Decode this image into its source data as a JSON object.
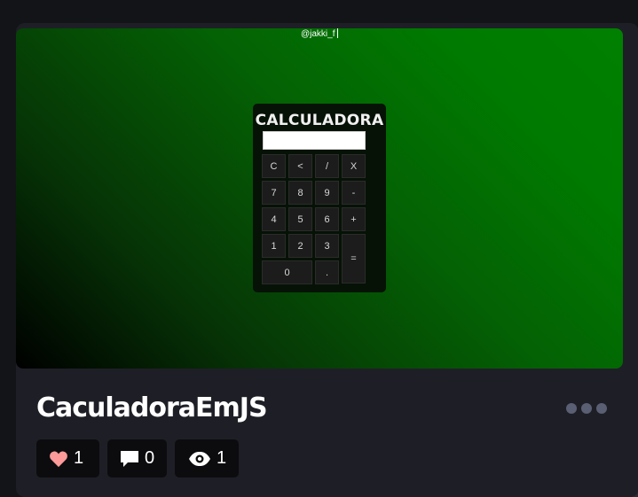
{
  "preview": {
    "author": "@jakki_f",
    "calculator": {
      "title": "CALCULADORA",
      "display_value": "",
      "keys": [
        "C",
        "<",
        "/",
        "X",
        "7",
        "8",
        "9",
        "-",
        "4",
        "5",
        "6",
        "+",
        "1",
        "2",
        "3",
        "=",
        "0",
        "."
      ]
    }
  },
  "card": {
    "title": "CaculadoraEmJS",
    "stats": {
      "likes": "1",
      "comments": "0",
      "views": "1"
    }
  },
  "colors": {
    "background": "#131417",
    "card": "#1e1f26",
    "heart": "#ff9a9a",
    "dots": "#5a5f73"
  },
  "icons": [
    "heart-icon",
    "comment-icon",
    "eye-icon",
    "more-options-icon"
  ]
}
